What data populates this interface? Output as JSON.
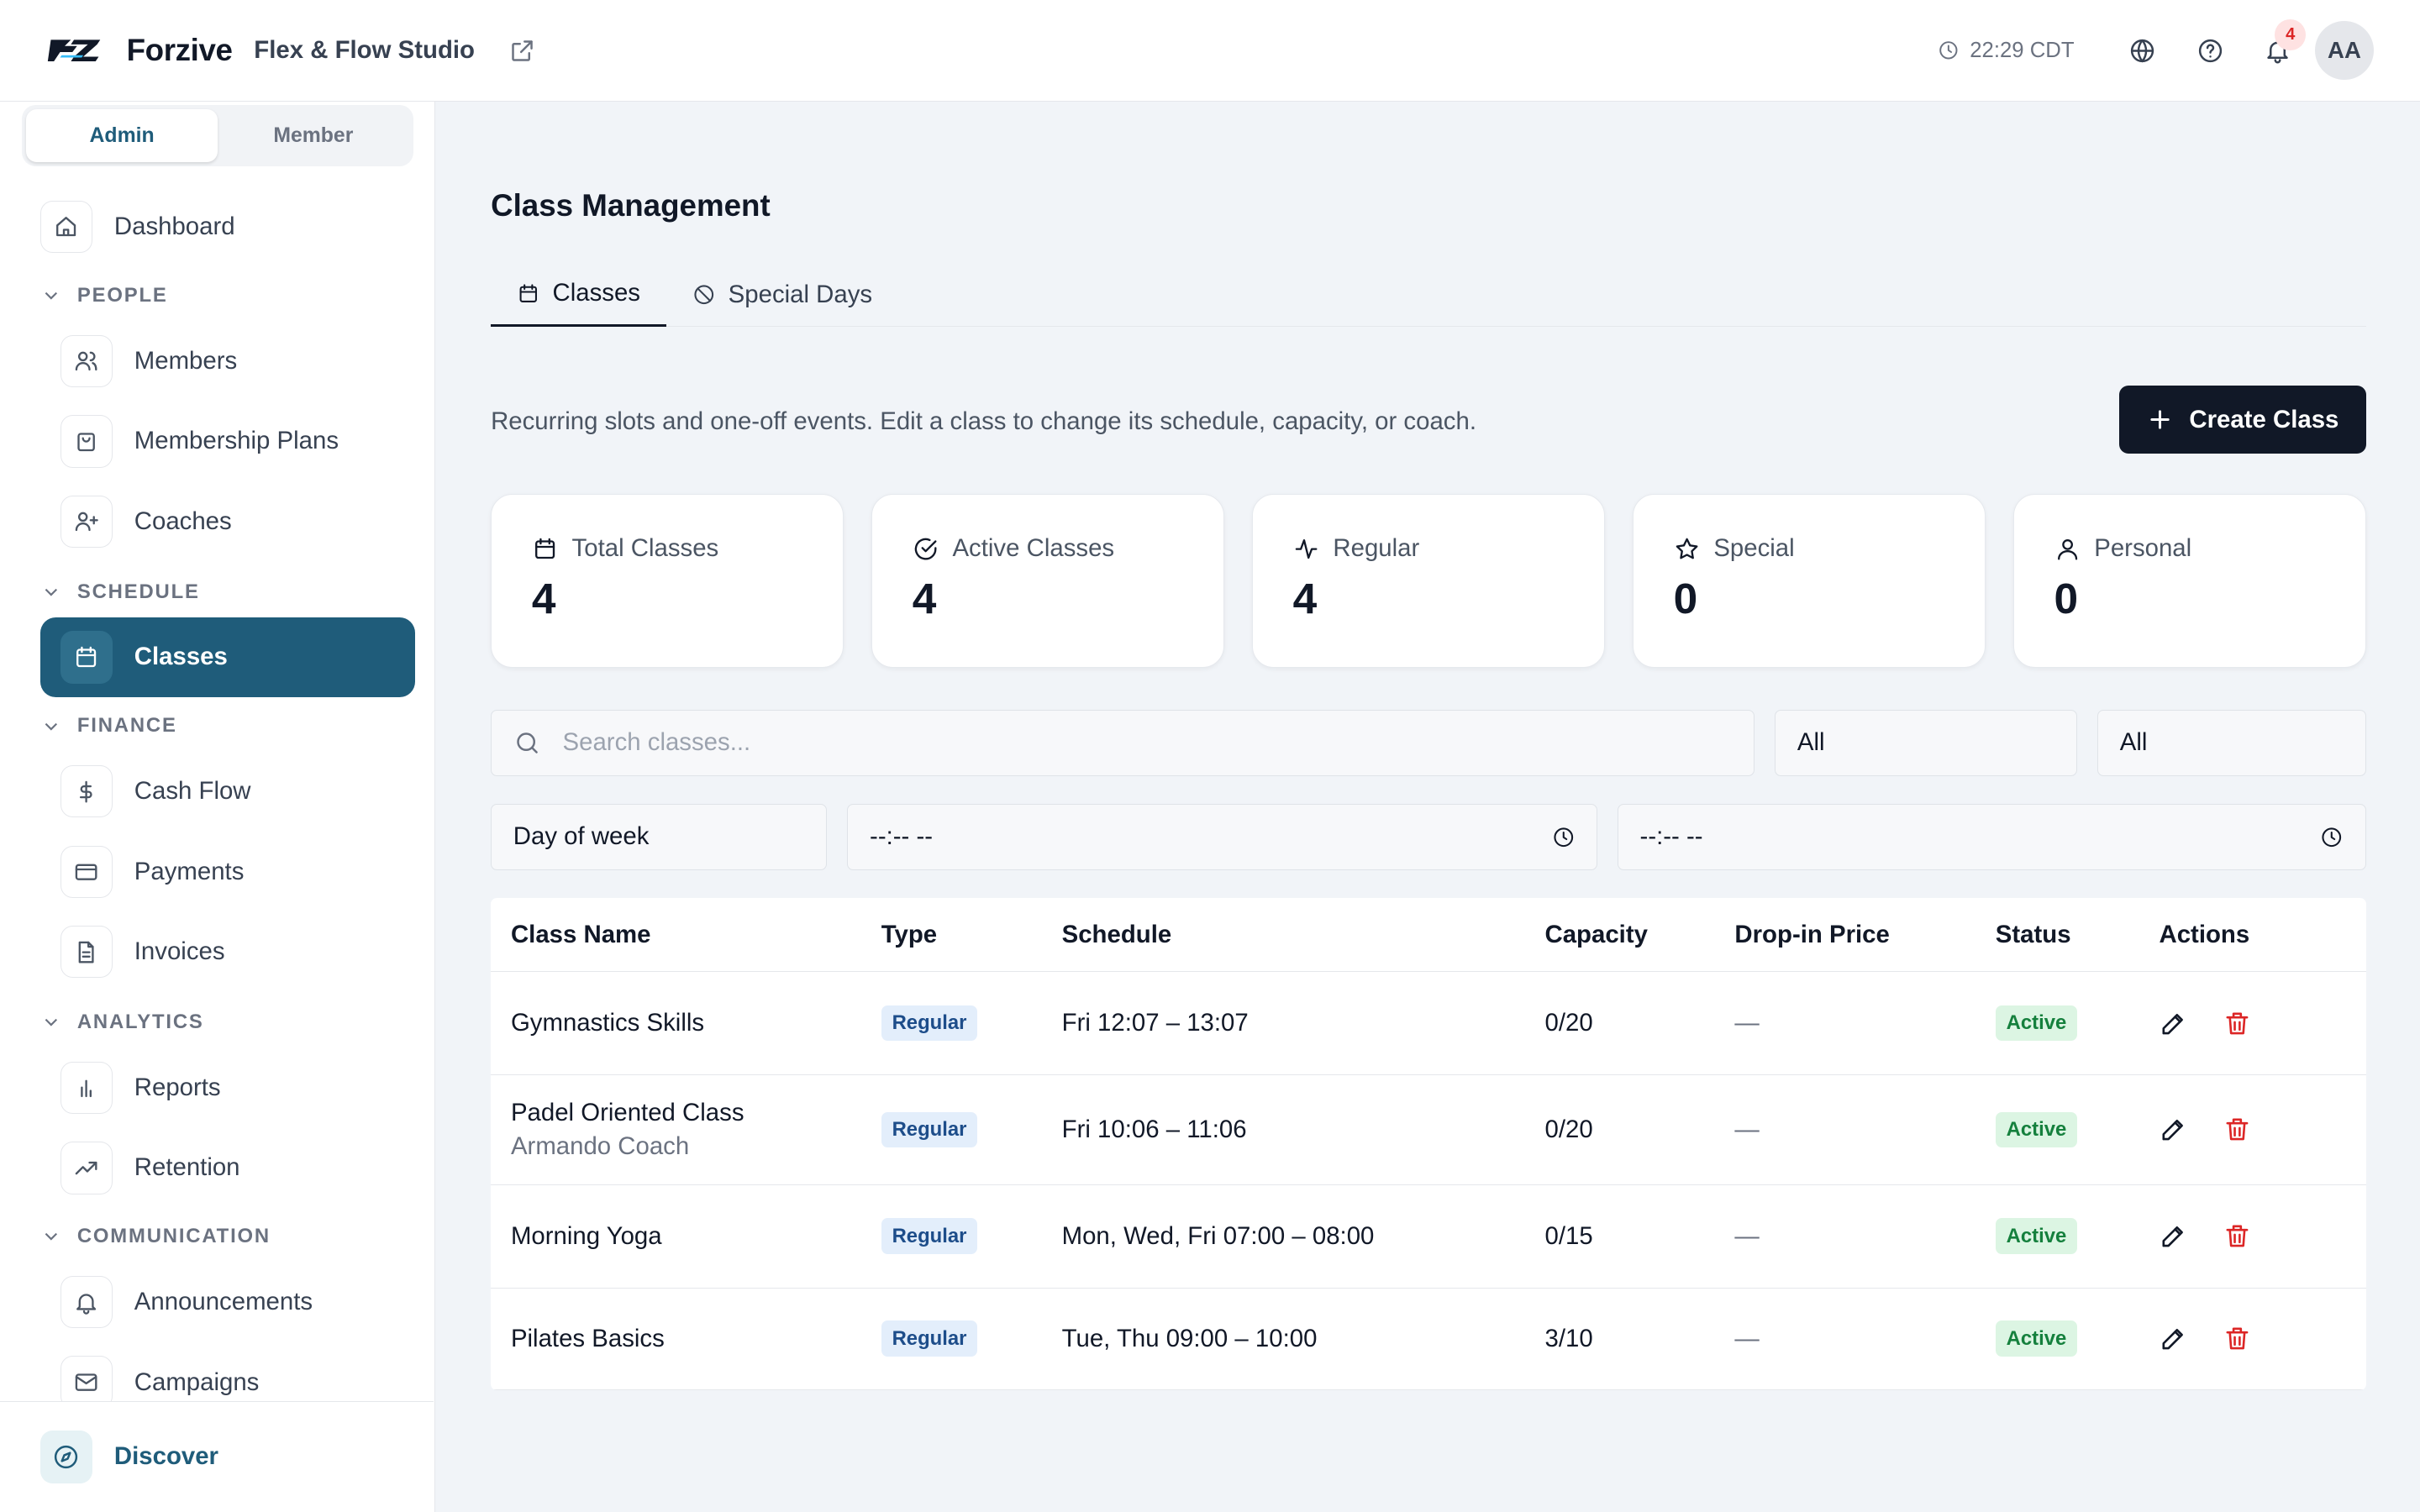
{
  "header": {
    "brand": "Forzive",
    "studio": "Flex & Flow Studio",
    "time": "22:29 CDT",
    "notification_count": "4",
    "avatar_initials": "AA"
  },
  "sidebar": {
    "role_toggle": {
      "admin": "Admin",
      "member": "Member",
      "selected": "Admin"
    },
    "dashboard": "Dashboard",
    "sections": {
      "people": "PEOPLE",
      "schedule": "SCHEDULE",
      "finance": "FINANCE",
      "analytics": "ANALYTICS",
      "communication": "COMMUNICATION"
    },
    "items": {
      "members": "Members",
      "membership_plans": "Membership Plans",
      "coaches": "Coaches",
      "classes": "Classes",
      "cash_flow": "Cash Flow",
      "payments": "Payments",
      "invoices": "Invoices",
      "reports": "Reports",
      "retention": "Retention",
      "announcements": "Announcements",
      "campaigns": "Campaigns"
    },
    "discover": "Discover"
  },
  "main": {
    "title": "Class Management",
    "tabs": [
      "Classes",
      "Special Days"
    ],
    "description": "Recurring slots and one-off events. Edit a class to change its schedule, capacity, or coach.",
    "create_button": "Create Class",
    "stats": [
      {
        "label": "Total Classes",
        "value": "4",
        "icon": "calendar-icon"
      },
      {
        "label": "Active Classes",
        "value": "4",
        "icon": "check-circle-icon"
      },
      {
        "label": "Regular",
        "value": "4",
        "icon": "activity-icon"
      },
      {
        "label": "Special",
        "value": "0",
        "icon": "star-icon"
      },
      {
        "label": "Personal",
        "value": "0",
        "icon": "user-icon"
      }
    ],
    "filters": {
      "search_placeholder": "Search classes...",
      "type_select": "All",
      "status_select": "All",
      "day_select": "Day of week",
      "time_from": "--:-- --",
      "time_to": "--:-- --"
    },
    "table": {
      "headers": [
        "Class Name",
        "Type",
        "Schedule",
        "Capacity",
        "Drop-in Price",
        "Status",
        "Actions"
      ],
      "rows": [
        {
          "name": "Gymnastics Skills",
          "coach": "",
          "type": "Regular",
          "schedule": "Fri 12:07 – 13:07",
          "capacity": "0/20",
          "price": "—",
          "status": "Active"
        },
        {
          "name": "Padel Oriented Class",
          "coach": "Armando Coach",
          "type": "Regular",
          "schedule": "Fri 10:06 – 11:06",
          "capacity": "0/20",
          "price": "—",
          "status": "Active"
        },
        {
          "name": "Morning Yoga",
          "coach": "",
          "type": "Regular",
          "schedule": "Mon, Wed, Fri 07:00 – 08:00",
          "capacity": "0/15",
          "price": "—",
          "status": "Active"
        },
        {
          "name": "Pilates Basics",
          "coach": "",
          "type": "Regular",
          "schedule": "Tue, Thu 09:00 – 10:00",
          "capacity": "3/10",
          "price": "—",
          "status": "Active"
        }
      ]
    }
  },
  "colors": {
    "accent": "#1f5c7a",
    "primary_button": "#111827",
    "type_badge_bg": "#e3eefb",
    "status_active_bg": "#dcf5e3",
    "delete": "#dc2626"
  }
}
